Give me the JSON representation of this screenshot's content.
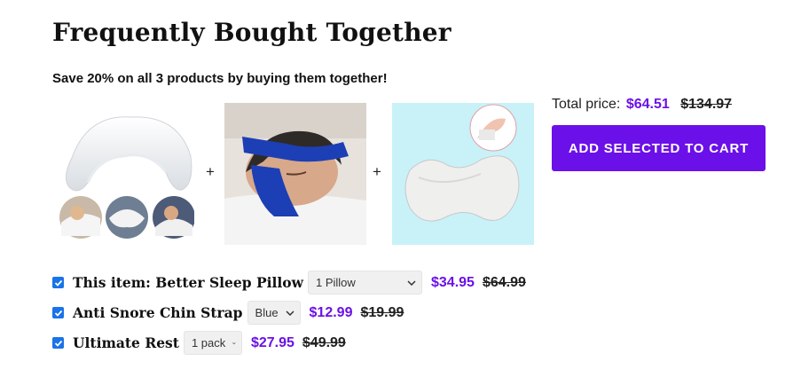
{
  "heading": "Frequently Bought Together",
  "subheading": "Save 20% on all 3 products by buying them together!",
  "total": {
    "label": "Total price:",
    "price": "$64.51",
    "old_price": "$134.97"
  },
  "cart_button": "ADD SELECTED TO CART",
  "plus_sign": "+",
  "colors": {
    "accent": "#6b10e8",
    "checkbox": "#1a73e8"
  },
  "items": [
    {
      "name": "This item: Better Sleep Pillow",
      "option": "1 Pillow",
      "price": "$34.95",
      "old_price": "$64.99",
      "checked": true
    },
    {
      "name": "Anti Snore Chin Strap",
      "option": "Blue",
      "price": "$12.99",
      "old_price": "$19.99",
      "checked": true
    },
    {
      "name": "Ultimate Rest",
      "option": "1 pack",
      "price": "$27.95",
      "old_price": "$49.99",
      "checked": true
    }
  ]
}
